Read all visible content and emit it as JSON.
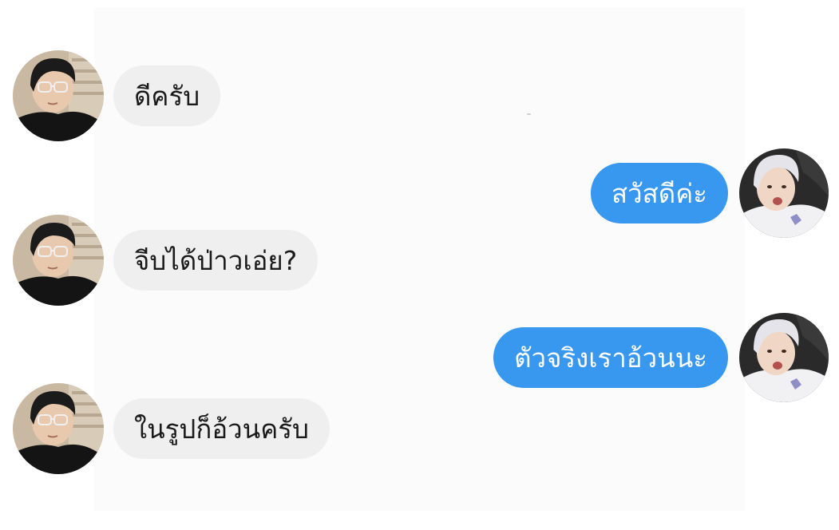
{
  "messages": [
    {
      "side": "incoming",
      "text": "ดีครับ",
      "avatar": "dark-haired-person-with-glasses"
    },
    {
      "side": "outgoing",
      "text": "สวัสดีค่ะ",
      "avatar": "light-haired-person"
    },
    {
      "side": "incoming",
      "text": "จีบได้ป่าวเอ่ย?",
      "avatar": "dark-haired-person-with-glasses"
    },
    {
      "side": "outgoing",
      "text": "ตัวจริงเราอ้วนนะ",
      "avatar": "light-haired-person"
    },
    {
      "side": "incoming",
      "text": "ในรูปก็อ้วนครับ",
      "avatar": "dark-haired-person-with-glasses"
    }
  ],
  "colors": {
    "incoming_bubble": "#efefef",
    "outgoing_bubble": "#3897ef",
    "incoming_text": "#1a1a1a",
    "outgoing_text": "#ffffff"
  }
}
